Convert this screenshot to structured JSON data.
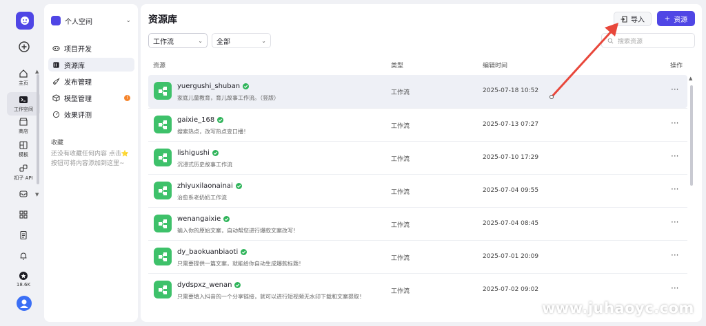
{
  "rail": {
    "items": [
      {
        "icon": "home-icon",
        "label": "主页"
      },
      {
        "icon": "terminal-icon",
        "label": "工作空间",
        "active": true
      },
      {
        "icon": "store-icon",
        "label": "商店"
      },
      {
        "icon": "template-icon",
        "label": "模板"
      },
      {
        "icon": "plugin-icon",
        "label": "扣子 API"
      }
    ],
    "stars": "18.6K"
  },
  "panel": {
    "space_name": "个人空间",
    "nav": [
      {
        "icon": "gamepad-icon",
        "label": "项目开发"
      },
      {
        "icon": "library-icon",
        "label": "资源库",
        "active": true
      },
      {
        "icon": "rocket-icon",
        "label": "发布管理"
      },
      {
        "icon": "cube-icon",
        "label": "模型管理",
        "badge": "!"
      },
      {
        "icon": "gauge-icon",
        "label": "效果评测"
      }
    ],
    "fav_title": "收藏",
    "fav_empty": "还没有收藏任何内容 点击⭐按钮可将内容添加到这里~"
  },
  "main": {
    "title": "资源库",
    "import_label": "导入",
    "add_label": "资源",
    "filter_type": "工作流",
    "filter_scope": "全部",
    "search_placeholder": "搜索资源",
    "columns": {
      "resource": "资源",
      "type": "类型",
      "time": "编辑时间",
      "action": "操作"
    },
    "rows": [
      {
        "name": "yuergushi_shuban",
        "desc": "家庭儿童教育，育儿故事工作流。（竖版）",
        "type": "工作流",
        "time": "2025-07-18 10:52"
      },
      {
        "name": "gaixie_168",
        "desc": "搜索热点，改写热点变口播！",
        "type": "工作流",
        "time": "2025-07-13 07:27"
      },
      {
        "name": "lishigushi",
        "desc": "沉浸式历史故事工作流",
        "type": "工作流",
        "time": "2025-07-10 17:29"
      },
      {
        "name": "zhiyuxilaonainai",
        "desc": "治愈系老奶奶工作流",
        "type": "工作流",
        "time": "2025-07-04 09:55"
      },
      {
        "name": "wenangaixie",
        "desc": "输入你的原始文案，自动帮您进行爆款文案改写！",
        "type": "工作流",
        "time": "2025-07-04 08:45"
      },
      {
        "name": "dy_baokuanbiaoti",
        "desc": "只需要提供一篇文案，就能给你自动生成爆款标题！",
        "type": "工作流",
        "time": "2025-07-01 20:09"
      },
      {
        "name": "dydspxz_wenan",
        "desc": "只需要填入抖音的一个分享链接，就可以进行短视频无水印下载和文案提取！",
        "type": "工作流",
        "time": "2025-07-02 09:02"
      }
    ]
  },
  "watermark": "www.juhaoyc.com",
  "colors": {
    "accent": "#4f46e5",
    "workflow_icon": "#3ec16a",
    "verified": "#2fb45a",
    "annotation_arrow": "#e8473b"
  }
}
